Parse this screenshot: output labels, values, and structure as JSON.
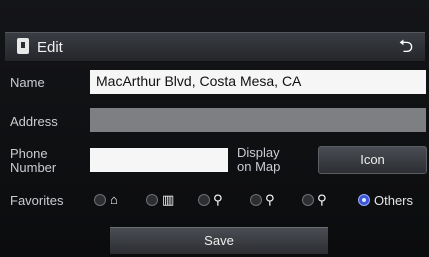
{
  "header": {
    "title": "Edit"
  },
  "fields": {
    "name_label": "Name",
    "name_value": "MacArthur Blvd, Costa Mesa, CA",
    "address_label": "Address",
    "address_value": "",
    "phone_label_line1": "Phone",
    "phone_label_line2": "Number",
    "phone_value": "",
    "display_label_line1": "Display",
    "display_label_line2": "on Map",
    "icon_button": "Icon"
  },
  "favorites": {
    "label": "Favorites",
    "options": [
      "home",
      "office",
      "fav-1",
      "fav-2",
      "fav-3",
      "Others"
    ],
    "selected": "Others",
    "others_label": "Others"
  },
  "actions": {
    "save_label": "Save"
  },
  "colors": {
    "selected_radio": "#3a57d6",
    "field_bg": "#f6f6f6"
  },
  "icons": {
    "edit": "edit-icon",
    "back": "back-icon",
    "home": "home-icon",
    "office": "building-icon",
    "pin": "pin-icon"
  }
}
